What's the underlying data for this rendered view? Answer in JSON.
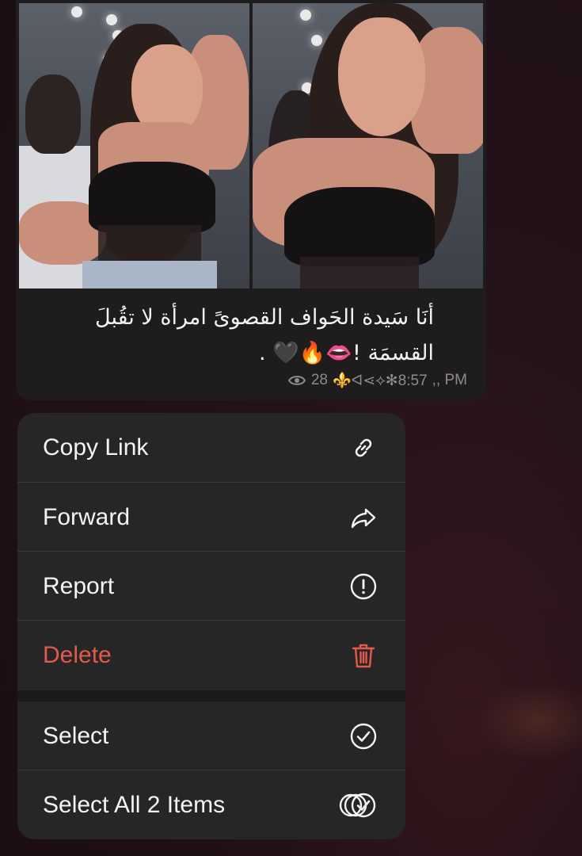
{
  "message": {
    "caption": "أنَا سَيدة الحَواف القصوىً امرأة لا تقُبلَ القسمَة !👄🔥🖤 .",
    "views": "28",
    "views_icon": "eye-icon",
    "signature": "⚜️ᐊ⋖⟡✻8:57",
    "time_suffix": ",, PM",
    "photos": [
      "photo-1",
      "photo-2"
    ]
  },
  "menu": {
    "items": [
      {
        "label": "Copy Link",
        "icon": "link-icon"
      },
      {
        "label": "Forward",
        "icon": "forward-arrow-icon"
      },
      {
        "label": "Report",
        "icon": "exclamation-circle-icon"
      },
      {
        "label": "Delete",
        "icon": "trash-icon",
        "color": "#e15a4c"
      },
      {
        "label": "Select",
        "icon": "check-circle-icon"
      },
      {
        "label": "Select All 2 Items",
        "icon": "multi-check-circle-icon"
      }
    ]
  },
  "colors": {
    "menu_bg": "#262626",
    "danger": "#e15a4c",
    "bubble_bg": "#1f1c1e",
    "meta_text": "#8e8b8d"
  }
}
